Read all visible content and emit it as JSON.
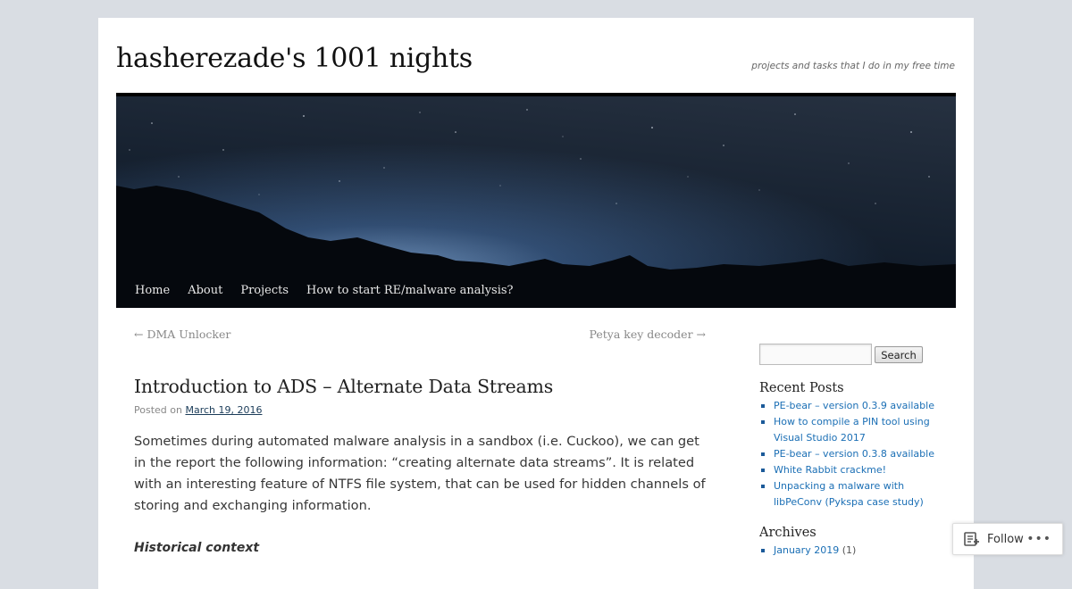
{
  "site": {
    "title": "hasherezade's 1001 nights",
    "tagline": "projects and tasks that I do in my free time"
  },
  "nav": {
    "items": [
      "Home",
      "About",
      "Projects",
      "How to start RE/malware analysis?"
    ]
  },
  "post_nav": {
    "prev": "← DMA Unlocker",
    "next": "Petya key decoder →"
  },
  "post": {
    "title": "Introduction to ADS – Alternate Data Streams",
    "meta_prefix": "Posted on",
    "date": "March 19, 2016",
    "paragraph": "Sometimes during automated malware analysis in a sandbox (i.e. Cuckoo), we can get in the report the following information: “creating alternate data streams”. It is related with an interesting feature of NTFS file system,  that can be used for hidden channels of storing and exchanging information.",
    "subheading": "Historical context"
  },
  "sidebar": {
    "search_button": "Search",
    "recent_title": "Recent Posts",
    "recent_posts": [
      "PE-bear – version 0.3.9 available",
      "How to compile a PIN tool using Visual Studio 2017",
      "PE-bear – version 0.3.8 available",
      "White Rabbit crackme!",
      "Unpacking a malware with libPeConv (Pykspa case study)"
    ],
    "archives_title": "Archives",
    "archives": [
      {
        "label": "January 2019",
        "count": "(1)"
      }
    ]
  },
  "follow_widget": {
    "label": "Follow",
    "icon": "reader-icon",
    "more": "•••"
  }
}
